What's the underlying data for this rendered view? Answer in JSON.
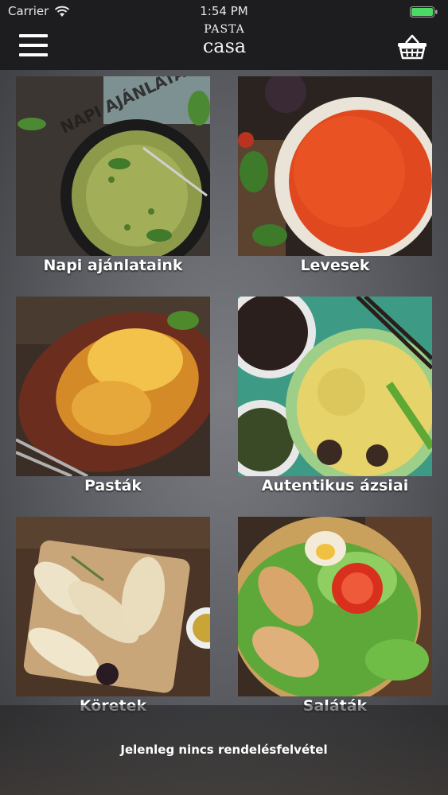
{
  "status_bar": {
    "carrier": "Carrier",
    "time": "1:54 PM"
  },
  "nav": {
    "logo_line1": "PASTA",
    "logo_line2": "casa"
  },
  "categories": [
    {
      "label": "Napi ajánlataink",
      "image_text": "NAPI AJÁNLATAINK"
    },
    {
      "label": "Levesek"
    },
    {
      "label": "Pasták"
    },
    {
      "label": "Autentikus ázsiai"
    },
    {
      "label": "Köretek"
    },
    {
      "label": "Saláták"
    }
  ],
  "banner": {
    "text": "Jelenleg nincs rendelésfelvétel"
  },
  "colors": {
    "bar_background": "#1d1d1f",
    "battery": "#4cd964"
  }
}
